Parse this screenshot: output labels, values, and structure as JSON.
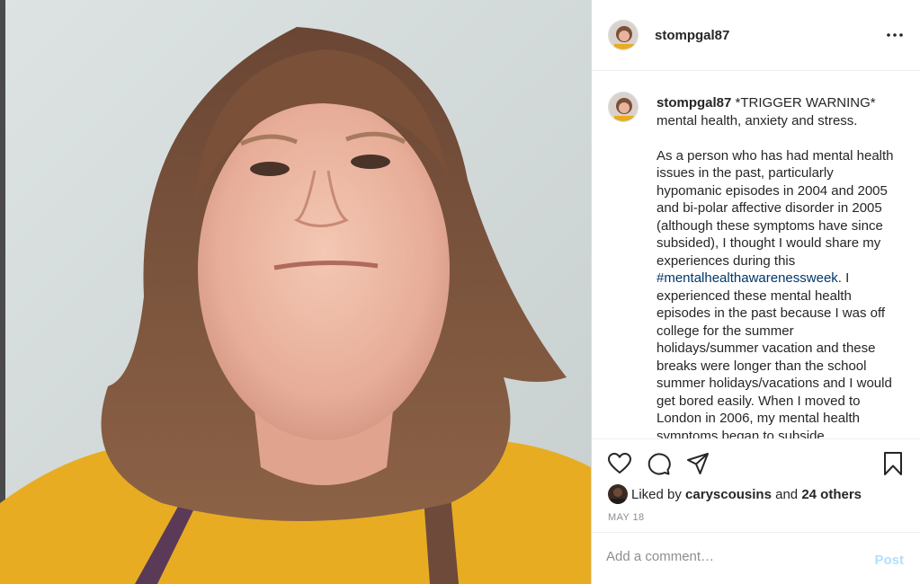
{
  "post": {
    "username": "stompgal87",
    "photo_alt": "Selfie photo"
  },
  "caption": {
    "username": "stompgal87",
    "first_line": " *TRIGGER WARNING* mental health, anxiety and stress.",
    "body_before_hashtag": "As a person who has had mental health issues in the past, particularly hypomanic episodes in 2004 and 2005 and bi-polar affective disorder in 2005 (although these symptoms have since subsided), I thought I would share my experiences during this ",
    "hashtag": "#mentalhealthawarenessweek",
    "body_after_hashtag": ". I experienced these mental health episodes in the past because I was off college for the summer holidays/summer vacation and these breaks were longer than the school summer holidays/vacations and I would get bored easily. When I moved to London in 2006, my mental health symptoms began to subside."
  },
  "actions": {
    "icons": [
      "heart-icon",
      "comment-icon",
      "share-icon",
      "bookmark-icon"
    ]
  },
  "likes": {
    "prefix": "Liked by ",
    "liker": "caryscousins",
    "middle": " and ",
    "others": "24 others"
  },
  "date": "MAY 18",
  "comment": {
    "placeholder": "Add a comment…",
    "post_label": "Post"
  },
  "colors": {
    "link": "#00376b",
    "post_disabled": "#b2dffc",
    "muted": "#8e8e8e",
    "text": "#262626"
  }
}
